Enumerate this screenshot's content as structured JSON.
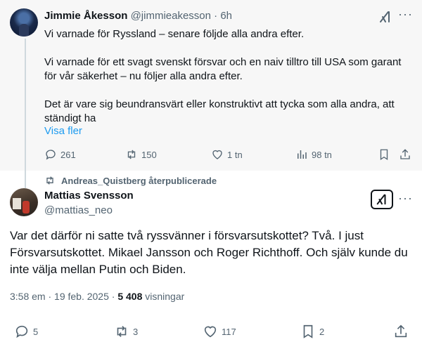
{
  "quoted_post": {
    "author_name": "Jimmie Åkesson",
    "author_handle": "@jimmieakesson",
    "separator": "·",
    "time": "6h",
    "paragraphs": [
      "Vi varnade för Ryssland – senare följde alla andra efter.",
      "Vi varnade för ett svagt svenskt försvar och en naiv tilltro till USA som garant för vår säkerhet – nu följer alla andra efter.",
      "Det är vare sig beundransvärt eller konstruktivt att tycka som alla andra, att ständigt ha"
    ],
    "show_more": "Visa fler",
    "replies": "261",
    "reposts": "150",
    "likes": "1 tn",
    "views": "98 tn",
    "more_glyph": "···"
  },
  "repost_notice": "Andreas_Quistberg återpublicerade",
  "main_post": {
    "author_name": "Mattias Svensson",
    "author_handle": "@mattias_neo",
    "text": "Var det därför ni satte två ryssvänner i försvarsutskottet? Två. I just Försvarsutskottet. Mikael Jansson och Roger Richthoff. Och själv kunde du inte välja mellan Putin och Biden.",
    "timestamp": "3:58 em · 19 feb. 2025 · ",
    "views_count": "5 408",
    "views_label": " visningar",
    "replies": "5",
    "reposts": "3",
    "likes": "117",
    "bookmarks": "2",
    "more_glyph": "···"
  },
  "icons": [
    "grok-icon",
    "more-icon",
    "reply-icon",
    "repost-icon",
    "like-icon",
    "views-icon",
    "bookmark-icon",
    "share-icon"
  ]
}
